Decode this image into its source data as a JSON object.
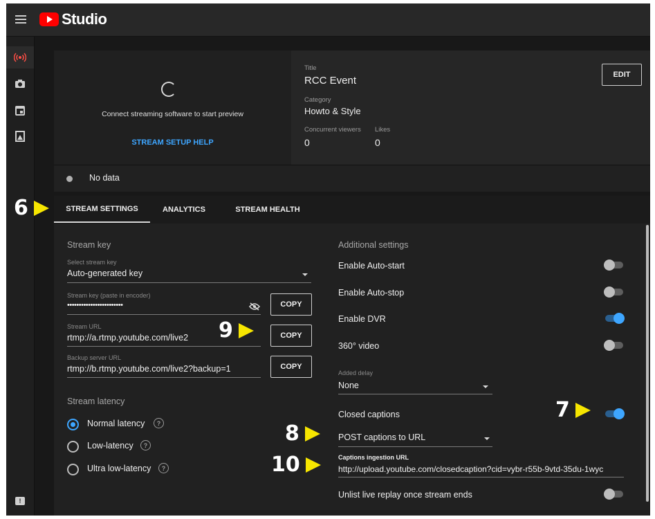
{
  "app": {
    "name": "Studio"
  },
  "nav": {
    "icons": [
      "live-broadcast-icon",
      "camera-icon",
      "calendar-icon",
      "manage-icon",
      "feedback-icon"
    ],
    "accent": "#ff4e45"
  },
  "preview": {
    "message": "Connect streaming software to start preview",
    "help_link": "STREAM SETUP HELP"
  },
  "info": {
    "title_label": "Title",
    "title": "RCC Event",
    "category_label": "Category",
    "category": "Howto & Style",
    "viewers_label": "Concurrent viewers",
    "viewers": "0",
    "likes_label": "Likes",
    "likes": "0",
    "edit_label": "EDIT"
  },
  "status": {
    "text": "No data"
  },
  "tabs": [
    {
      "label": "STREAM SETTINGS",
      "active": true
    },
    {
      "label": "ANALYTICS",
      "active": false
    },
    {
      "label": "STREAM HEALTH",
      "active": false
    }
  ],
  "stream_key": {
    "section": "Stream key",
    "select_label": "Select stream key",
    "select_value": "Auto-generated key",
    "key_label": "Stream key (paste in encoder)",
    "key_value": "••••••••••••••••••••••••",
    "url_label": "Stream URL",
    "url_value": "rtmp://a.rtmp.youtube.com/live2",
    "backup_label": "Backup server URL",
    "backup_value": "rtmp://b.rtmp.youtube.com/live2?backup=1",
    "copy_label": "COPY"
  },
  "latency": {
    "section": "Stream latency",
    "options": [
      {
        "label": "Normal latency",
        "selected": true
      },
      {
        "label": "Low-latency",
        "selected": false
      },
      {
        "label": "Ultra low-latency",
        "selected": false
      }
    ]
  },
  "additional": {
    "section": "Additional settings",
    "auto_start": {
      "label": "Enable Auto-start",
      "on": false
    },
    "auto_stop": {
      "label": "Enable Auto-stop",
      "on": false
    },
    "dvr": {
      "label": "Enable DVR",
      "on": true
    },
    "video360": {
      "label": "360° video",
      "on": false
    },
    "delay_label": "Added delay",
    "delay_value": "None",
    "captions": {
      "label": "Closed captions",
      "on": true
    },
    "captions_method": "POST captions to URL",
    "ingestion_label": "Captions ingestion URL",
    "ingestion_value": "http://upload.youtube.com/closedcaption?cid=vybr-r55b-9vtd-35du-1wyc",
    "unlist": {
      "label": "Unlist live replay once stream ends",
      "on": false
    }
  },
  "callouts": [
    "6",
    "7",
    "8",
    "9",
    "10"
  ],
  "colors": {
    "accent_blue": "#3ea6ff",
    "callout_arrow": "#f7e600"
  }
}
